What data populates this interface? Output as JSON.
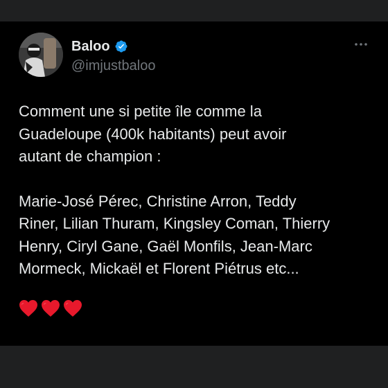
{
  "tweet": {
    "display_name": "Baloo",
    "handle": "@imjustbaloo",
    "verified": true,
    "paragraphs": [
      "Comment une si petite île comme la\nGuadeloupe (400k habitants) peut avoir\nautant de champion :",
      "Marie-José Pérec, Christine Arron, Teddy\nRiner, Lilian Thuram, Kingsley Coman, Thierry\nHenry, Ciryl Gane, Gaël Monfils, Jean-Marc\nMormeck, Mickaël et Florent Piétrus etc..."
    ],
    "hearts": [
      "red-heart-icon",
      "red-heart-icon",
      "red-heart-icon"
    ]
  },
  "colors": {
    "page_bg": "#1f2021",
    "tweet_bg": "#000000",
    "text": "#e7e9ea",
    "muted": "#71767b",
    "verified_blue": "#1d9bf0",
    "heart_red": "#e8192c"
  }
}
